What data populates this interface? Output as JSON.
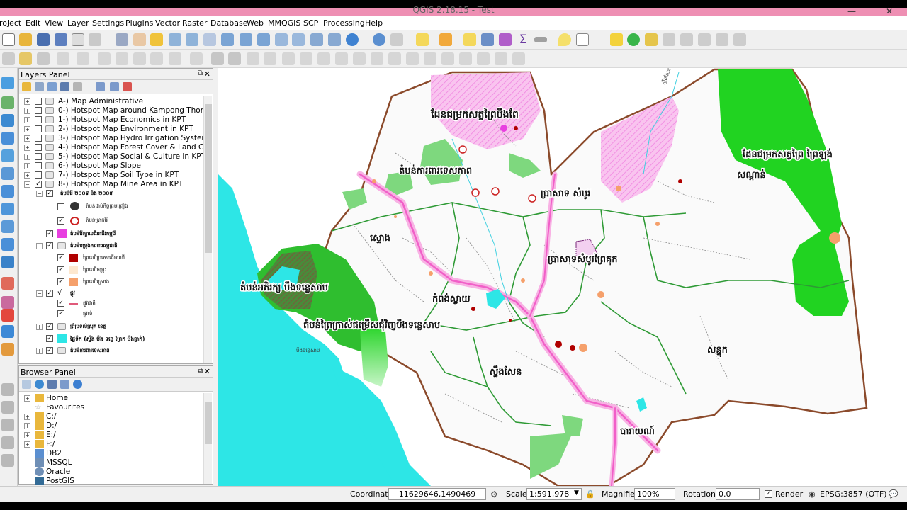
{
  "window": {
    "title": "QGIS 2.18.15 - Test",
    "minimize": "—",
    "close": "✕"
  },
  "menu": [
    "roject",
    "Edit",
    "View",
    "Layer",
    "Settings",
    "Plugins",
    "Vector",
    "Raster",
    "Database",
    "Web",
    "MMQGIS",
    "SCP",
    "Processing",
    "Help"
  ],
  "layers_panel": {
    "title": "Layers Panel",
    "layers": [
      "A-) Map Administrative",
      "0-) Hotspot Map around Kampong Thom",
      "1-) Hotspot Map Economics in KPT",
      "2-) Hotspot Map Environment in KPT",
      "3-) Hotspot Map Hydro Irrigation System ...",
      "4-) Hotspot Map Forest Cover & Land Cov...",
      "5-) Hotspot Map Social & Culture in KPT",
      "6-) Hotspot Map Slope",
      "7-) Hotspot Map Soil Type in KPT",
      "8-) Hotspot Map Mine Area in KPT"
    ],
    "sublayers": [
      "តំបន់រ៉ែ ២០០៩ និង ២០០៣",
      "តំបន់ជាប់កិច្ចព្រមព្រៀង",
      "តំបន់ប្រាក់រ៉ែ",
      "តំបន់រ៉ែក្បាលដីអាជីវកម្មរ៉ែ",
      "តំបន់បម្រុងការពារធម្មជាតិ",
      "ព្រៃឈើប្រភេទដើមឈើ",
      "ព្រៃឈើចម្រុះ",
      "ព្រៃឈើស្រោង",
      "ផ្លូវ",
      "ផ្លូវជាតិ",
      "ផ្លូវលំ",
      "ព្រំប្រទល់ស្រុក ខេត្ត",
      "ផ្ទៃទឹក (ស្ទឹង បឹង ទន្លេ ព្រែក បឹងធ្លាក់)",
      "តំបន់ការពារទេសភាព"
    ]
  },
  "browser_panel": {
    "title": "Browser Panel",
    "items": [
      "Home",
      "Favourites",
      "C:/",
      "D:/",
      "E:/",
      "F:/",
      "DB2",
      "MSSQL",
      "Oracle",
      "PostGIS"
    ]
  },
  "map": {
    "labels": {
      "north": "ដែនជម្រកសត្វព្រៃបឹងពែ",
      "east": "ដែនជម្រកសត្វព្រៃ ព្រៃឡង់",
      "center_north": "តំបន់ការពារទេសភាព",
      "sambo": "ប្រាសាទ សំបូរ",
      "sandan": "សណ្ដាន់",
      "stoung": "ស្ទោង",
      "prasat": "ប្រាសាទសំបូរព្រៃគុក",
      "boeng": "តំបន់អភិរក្ស បឹងទន្លេសាប",
      "kampong_svay": "កំពង់ស្វាយ",
      "tonle_sap_area": "តំបន់ព្រៃក្រាស់ជម្រើសជុំវិញបឹងទន្លេសាប",
      "santuk": "សន្ទុក",
      "stueng_saen": "ស្ទឹងសែន",
      "baray": "បារាយណ៍",
      "lake": "បឹងទន្លេសាប",
      "river": "ស្ទឹងសែន"
    }
  },
  "statusbar": {
    "coordinate_label": "Coordinate",
    "coordinate_value": "11629646,1490469",
    "scale_label": "Scale",
    "scale_value": "1:591,978",
    "magnifier_label": "Magnifier",
    "magnifier_value": "100%",
    "rotation_label": "Rotation",
    "rotation_value": "0.0",
    "render_label": "Render",
    "crs": "EPSG:3857 (OTF)"
  },
  "colors": {
    "green_forest": "#21d321",
    "cyan_water": "#2de6e6",
    "pink_reserve": "#f2a0e6",
    "boundary": "#8b4a2b",
    "district": "#2e9a35",
    "road": "#f15fc8"
  }
}
